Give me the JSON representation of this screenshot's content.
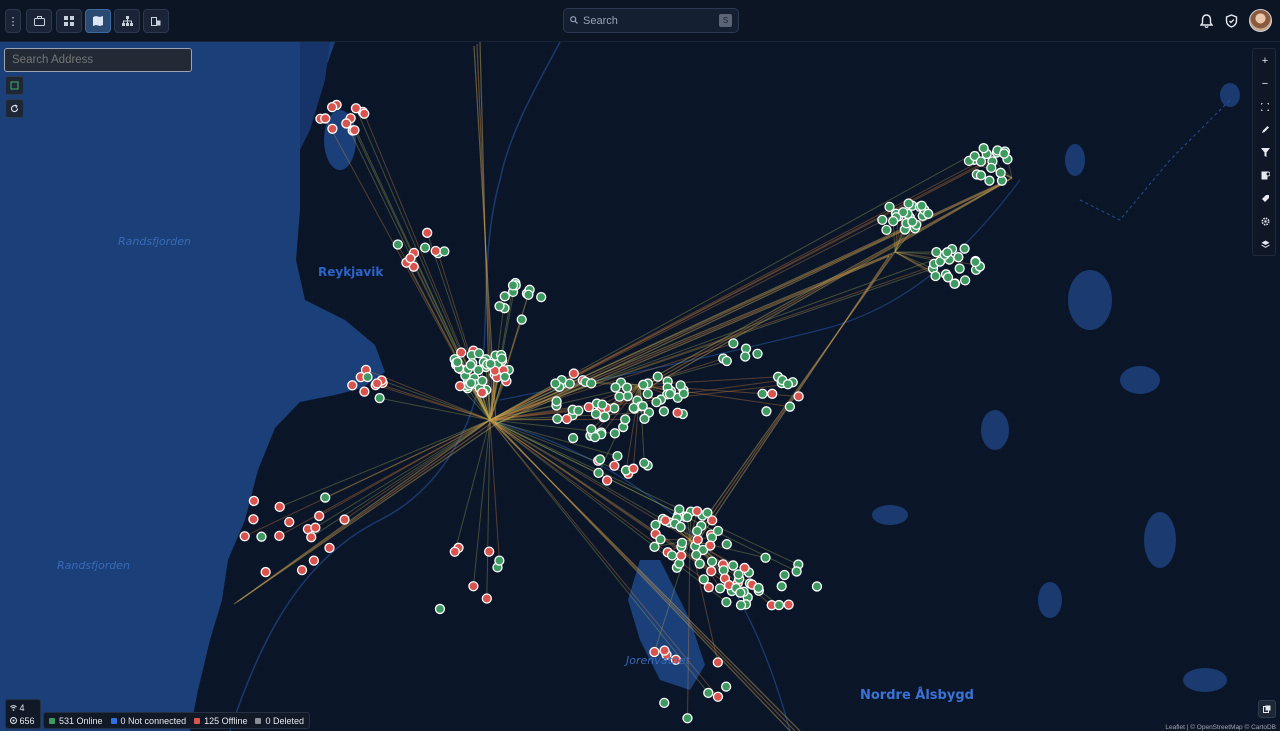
{
  "topbar": {
    "search_label": "Search",
    "search_shortcut": "S",
    "buttons": [
      {
        "name": "menu-button",
        "icon": "more-vertical-icon"
      },
      {
        "name": "toolbox-button",
        "icon": "briefcase-icon"
      },
      {
        "name": "dashboard-button",
        "icon": "dashboard-icon"
      },
      {
        "name": "map-view-button",
        "icon": "map-icon"
      },
      {
        "name": "topology-button",
        "icon": "hierarchy-icon"
      },
      {
        "name": "buildings-button",
        "icon": "building-icon"
      }
    ]
  },
  "map": {
    "address_placeholder": "Search Address",
    "labels": {
      "randsfjorden_top": "Randsfjorden",
      "reykjavik": "Reykjavik",
      "randsfjorden_bottom": "Randsfjorden",
      "jorenvatnet": "Jorenvatnet",
      "nordre_alsbygd": "Nordre Ålsbygd"
    },
    "attribution": "Leaflet | © OpenStreetMap © CartoDB",
    "colors": {
      "online": "#3f9a62",
      "offline": "#d9534f",
      "not_connected": "#2f6fe0",
      "deleted": "#8a8f98",
      "water": "#1d4683",
      "land": "#0c1628"
    }
  },
  "stats": {
    "wifi_count": "4",
    "node_count": "656"
  },
  "legend": [
    {
      "label": "531 Online",
      "color": "#3f9a62"
    },
    {
      "label": "0 Not connected",
      "color": "#2f6fe0"
    },
    {
      "label": "125 Offline",
      "color": "#d9534f"
    },
    {
      "label": "0 Deleted",
      "color": "#8a8f98"
    }
  ]
}
